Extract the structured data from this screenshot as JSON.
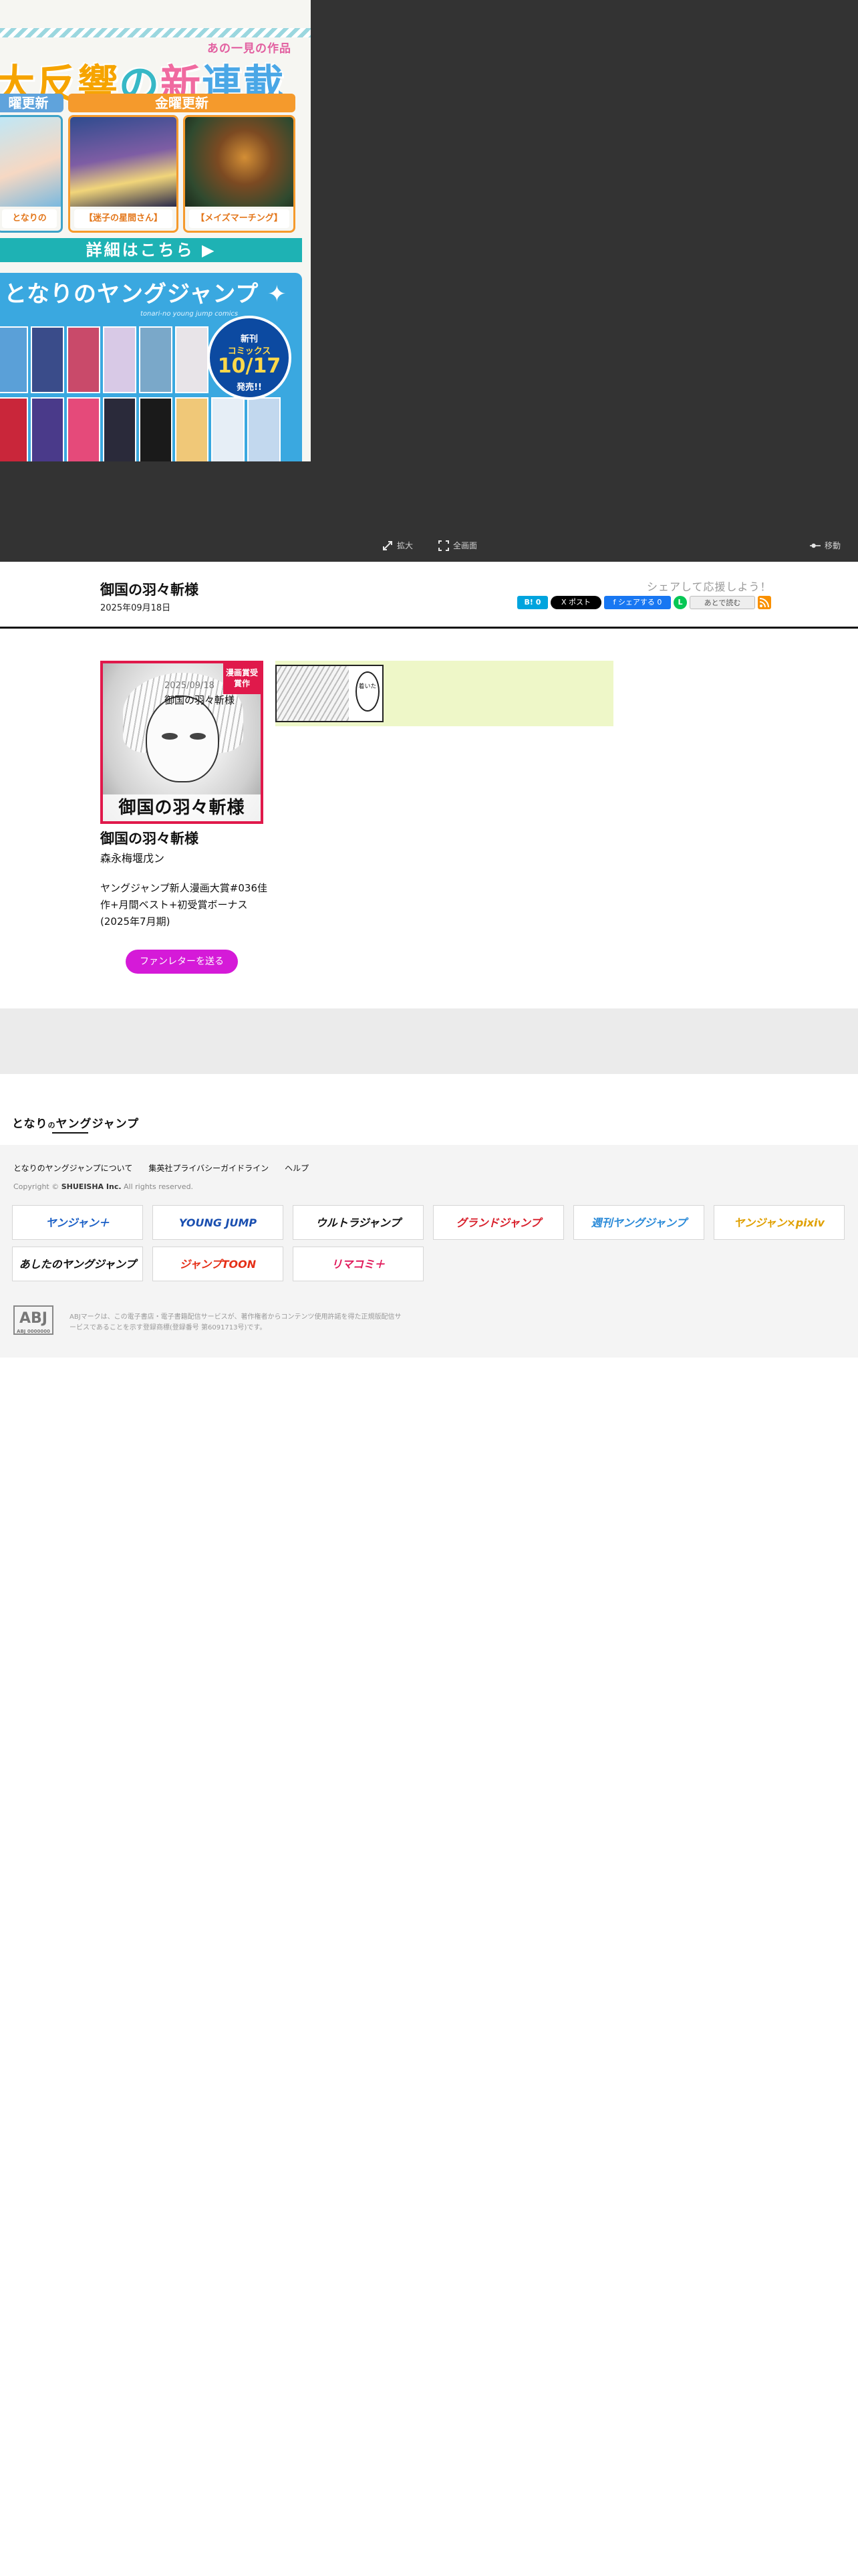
{
  "viewer": {
    "promo": {
      "ruby": "あの一見の作品",
      "headline_parts": [
        "大反響",
        "の",
        "新",
        "連載"
      ],
      "day_left": "曜更新",
      "day_right": "金曜更新",
      "card1_caption": "となりの",
      "card2_caption": "【迷子の星間さん】",
      "card3_caption": "【メイズマーチング】",
      "details": "詳細はこちら ▶",
      "yj_heading": "となりのヤングジャンプ ✦",
      "yj_sub": "tonari-no young jump comics",
      "badge_line1": "新刊",
      "badge_line2": "コミックス",
      "badge_date": "10/17",
      "badge_line4": "発売!!"
    },
    "controls": {
      "expand_label": "拡大",
      "fullscreen_label": "全画面",
      "move_label": "移動"
    }
  },
  "header": {
    "title": "御国の羽々斬様",
    "date": "2025年09月18日",
    "share_label": "シェアして応援しよう！",
    "share_buttons": {
      "hatena": "B! 0",
      "x": "X ポスト",
      "facebook": "f シェアする 0",
      "line": "L",
      "later": "あとで読む",
      "rss": "▤"
    }
  },
  "series": {
    "cover_badge": "漫画賞受賞作",
    "cover_title": "御国の羽々斬様",
    "name": "御国の羽々斬様",
    "author": "森永梅堰戊ン",
    "description": "ヤングジャンプ新人漫画大賞#036佳作+月間ベスト+初受賞ボーナス(2025年7月期)",
    "fan_letter_button": "ファンレターを送る"
  },
  "episodes": [
    {
      "date": "2025/09/18",
      "title": "御国の羽々斬様",
      "thumb_bubble": "着いた"
    }
  ],
  "footer": {
    "logo_a": "となり",
    "logo_b": "の",
    "logo_c": "ヤングジャンプ",
    "links": [
      "となりのヤングジャンプについて",
      "集英社プライバシーガイドライン",
      "ヘルプ"
    ],
    "copyright_prefix": "Copyright ©",
    "copyright_company": "SHUEISHA Inc.",
    "copyright_suffix": "All rights reserved.",
    "sites": [
      {
        "label": "ヤンジャン＋",
        "color": "#1a5fc6"
      },
      {
        "label": "YOUNG JUMP",
        "color": "#1a4fb0"
      },
      {
        "label": "ウルトラジャンプ",
        "color": "#111111"
      },
      {
        "label": "グランドジャンプ",
        "color": "#d81e2a"
      },
      {
        "label": "週刊ヤングジャンプ",
        "color": "#2a8ad8"
      },
      {
        "label": "ヤンジャン×pixiv",
        "color": "#e0a000"
      },
      {
        "label": "あしたのヤングジャンプ",
        "color": "#111111"
      },
      {
        "label": "ジャンプTOON",
        "color": "#e53018"
      },
      {
        "label": "リマコミ＋",
        "color": "#e0195a"
      }
    ],
    "abj_mark": "ABJ",
    "abj_small": "ABJ 0000000",
    "abj_text": "ABJマークは、この電子書店・電子書籍配信サービスが、著作権者からコンテンツ使用許諾を得た正規版配信サービスであることを示す登録商標(登録番号 第6091713号)です。"
  }
}
